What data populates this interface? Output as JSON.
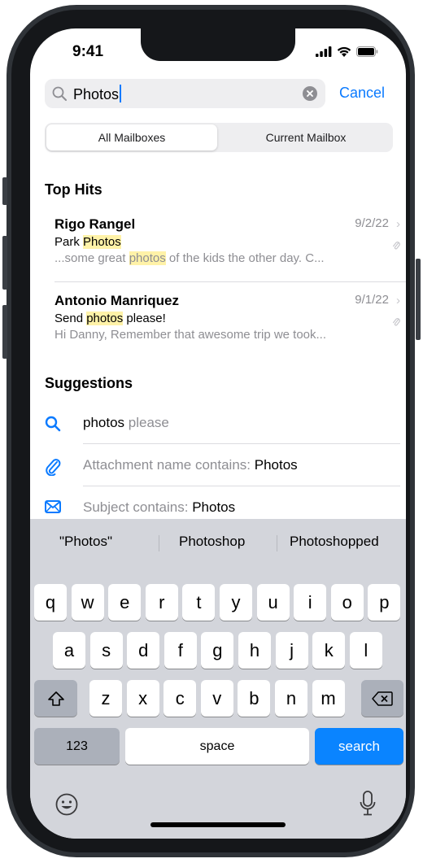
{
  "status": {
    "time": "9:41"
  },
  "search": {
    "query": "Photos",
    "cancel_label": "Cancel"
  },
  "scope": {
    "all": "All Mailboxes",
    "current": "Current Mailbox"
  },
  "top_hits": {
    "title": "Top Hits",
    "items": [
      {
        "from": "Rigo Rangel",
        "date": "9/2/22",
        "subject_pre": "Park ",
        "subject_hl": "Photos",
        "subject_post": "",
        "preview_pre": "...some great ",
        "preview_hl": "photos",
        "preview_post": " of the kids the other day. C..."
      },
      {
        "from": "Antonio Manriquez",
        "date": "9/1/22",
        "subject_pre": "Send ",
        "subject_hl": "photos",
        "subject_post": " please!",
        "preview_pre": "Hi Danny, Remember that awesome trip we took...",
        "preview_hl": "",
        "preview_post": ""
      }
    ]
  },
  "suggestions": {
    "title": "Suggestions",
    "items": [
      {
        "icon": "search-icon",
        "bold": "photos",
        "rest": " please"
      },
      {
        "icon": "paperclip-icon",
        "prefix": "Attachment name contains: ",
        "bold": "Photos"
      },
      {
        "icon": "envelope-icon",
        "prefix": "Subject contains: ",
        "bold": "Photos"
      }
    ]
  },
  "keyboard": {
    "predictions": [
      "\"Photos\"",
      "Photoshop",
      "Photoshopped"
    ],
    "row1": [
      "q",
      "w",
      "e",
      "r",
      "t",
      "y",
      "u",
      "i",
      "o",
      "p"
    ],
    "row2": [
      "a",
      "s",
      "d",
      "f",
      "g",
      "h",
      "j",
      "k",
      "l"
    ],
    "row3": [
      "z",
      "x",
      "c",
      "v",
      "b",
      "n",
      "m"
    ],
    "numbers_label": "123",
    "space_label": "space",
    "search_label": "search"
  },
  "colors": {
    "accent": "#0a7aff",
    "highlight": "#fff2a8",
    "keyboard_bg": "#d3d5db"
  }
}
